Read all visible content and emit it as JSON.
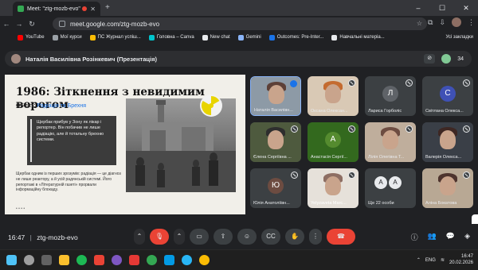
{
  "browser": {
    "tab_title": "Meet: \"ztg-mozb-evo\"",
    "url": "meet.google.com/ztg-mozb-evo",
    "bookmarks": [
      "YouTube",
      "Мої курси",
      "ПС Журнал успіш...",
      "Головна – Canva",
      "New chat",
      "Gemini",
      "Outcomes: Pre-Inter...",
      "Навчальні матеріа..."
    ],
    "bookmarks_right": "Усі закладки"
  },
  "presenter": {
    "label": "Наталія Василівна Розінкевич (Презентація)",
    "participant_count": "34"
  },
  "slide": {
    "title": "1986: Зіткнення з невидимим ворогом",
    "subject_label": "Об'єкт:",
    "subject_value": "Радіація та Брехня",
    "box_text": "Щербак прибув у Зону як лікар і репортер. Він побачив не лише радіацію, але й тотальну брехню системи.",
    "note_text": "Щербак одним із перших зрозумів: радіація — це діагноз не лише реактору, а й усій радянській системі. Його репортажі в «Літературній газеті» прорвали інформаційну блокаду.",
    "dots": "• • • •"
  },
  "tiles": [
    {
      "name": "Наталія Василівн...",
      "type": "video",
      "state": "speaking"
    },
    {
      "name": "Оксана Олексан...",
      "type": "video",
      "state": "muted"
    },
    {
      "name": "Лариса Горболіс",
      "type": "letter",
      "letter": "Л",
      "color": "#5f6368",
      "state": "muted"
    },
    {
      "name": "Світлана Олекса...",
      "type": "letter",
      "letter": "С",
      "color": "#3f51b5",
      "state": "muted"
    },
    {
      "name": "Єлена Сергіївна ...",
      "type": "video",
      "state": "muted"
    },
    {
      "name": "Анастасія Сергії...",
      "type": "letter",
      "letter": "А",
      "color": "#33691e",
      "state": "muted"
    },
    {
      "name": "Лілія Олегівна Т...",
      "type": "video",
      "state": "muted"
    },
    {
      "name": "Валерія Олекса...",
      "type": "video",
      "state": "muted"
    },
    {
      "name": "Юлія Анатоліївн...",
      "type": "letter",
      "letter": "Ю",
      "color": "#6d4c41",
      "state": "muted"
    },
    {
      "name": "Yelyzaveta Marc...",
      "type": "video",
      "state": "muted"
    },
    {
      "name": "Ще 22 особи",
      "type": "more",
      "letters": [
        "А",
        "А"
      ],
      "state": "none"
    },
    {
      "name": "Аліна Бокатова",
      "type": "video",
      "state": "muted"
    }
  ],
  "bottom": {
    "time": "16:47",
    "meeting_code": "ztg-mozb-evo"
  },
  "taskbar": {
    "lang": "ENG",
    "time": "16:47",
    "date": "20.02.2026"
  }
}
